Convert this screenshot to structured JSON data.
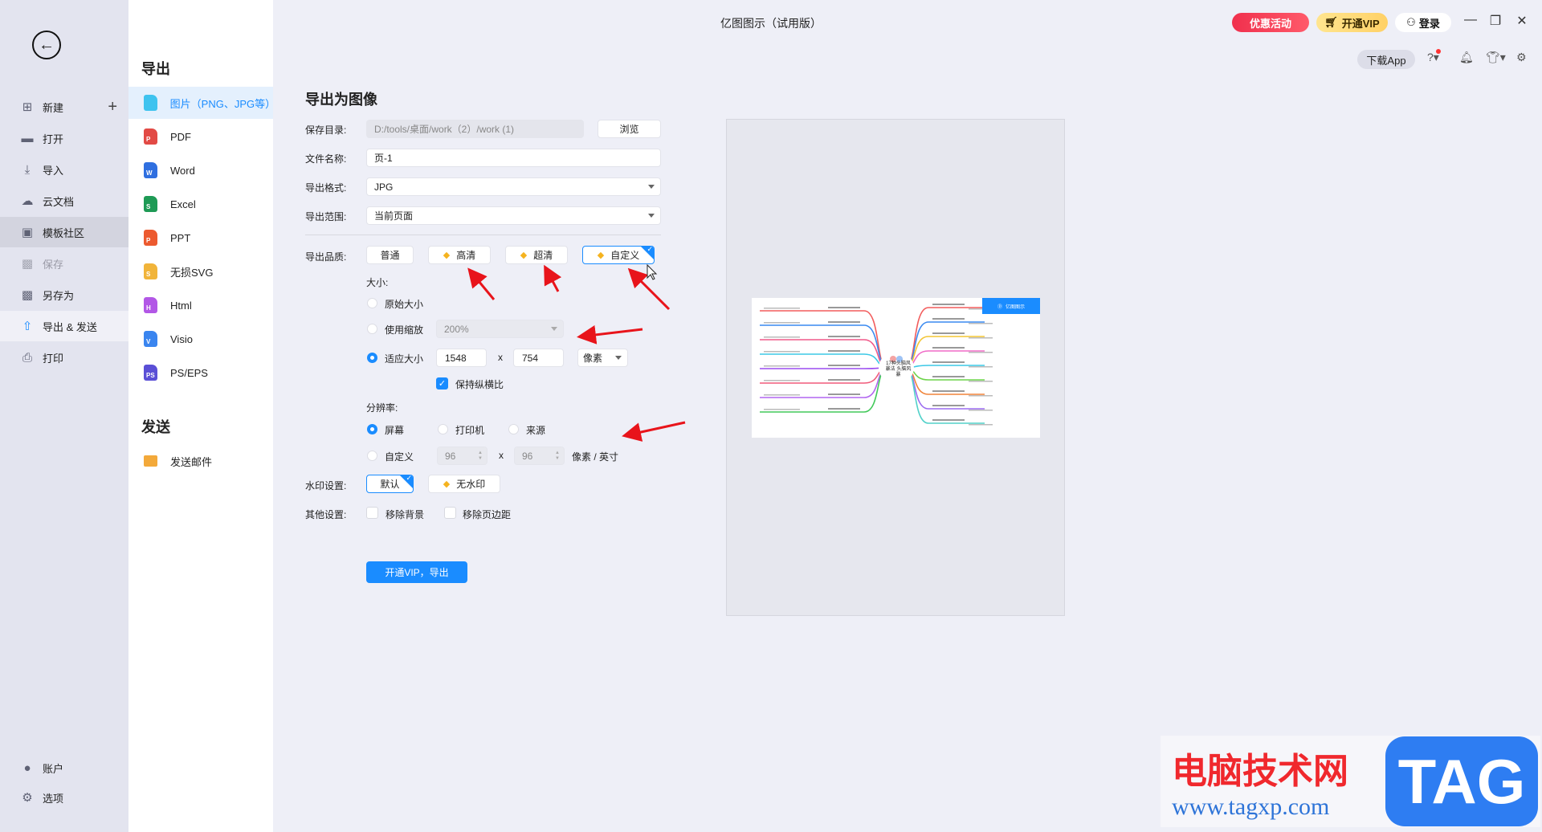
{
  "window": {
    "title": "亿图图示（试用版）",
    "promo": "优惠活动",
    "vip": "开通VIP",
    "login": "登录",
    "download_app": "下载App"
  },
  "sidebar": {
    "items": [
      {
        "label": "新建",
        "icon": "plus-square-icon"
      },
      {
        "label": "打开",
        "icon": "folder-icon"
      },
      {
        "label": "导入",
        "icon": "import-icon"
      },
      {
        "label": "云文档",
        "icon": "cloud-icon"
      },
      {
        "label": "模板社区",
        "icon": "community-icon"
      },
      {
        "label": "保存",
        "icon": "save-icon"
      },
      {
        "label": "另存为",
        "icon": "save-as-icon"
      },
      {
        "label": "导出 & 发送",
        "icon": "export-icon"
      },
      {
        "label": "打印",
        "icon": "printer-icon"
      }
    ],
    "bottom": [
      {
        "label": "账户",
        "icon": "account-icon"
      },
      {
        "label": "选项",
        "icon": "gear-icon"
      }
    ]
  },
  "panel": {
    "export_heading": "导出",
    "export_items": [
      {
        "label": "图片（PNG、JPG等）",
        "color": "#3ec3ef",
        "letter": ""
      },
      {
        "label": "PDF",
        "color": "#e24a45",
        "letter": "P"
      },
      {
        "label": "Word",
        "color": "#2f6fe0",
        "letter": "W"
      },
      {
        "label": "Excel",
        "color": "#1e9a55",
        "letter": "S"
      },
      {
        "label": "PPT",
        "color": "#ec5a2f",
        "letter": "P"
      },
      {
        "label": "无损SVG",
        "color": "#f1b43a",
        "letter": "S"
      },
      {
        "label": "Html",
        "color": "#b257e6",
        "letter": "H"
      },
      {
        "label": "Visio",
        "color": "#3a85ef",
        "letter": "V"
      },
      {
        "label": "PS/EPS",
        "color": "#5a4fd6",
        "letter": "PS"
      }
    ],
    "send_heading": "发送",
    "send_items": [
      {
        "label": "发送邮件",
        "color": "#f3a93a"
      }
    ]
  },
  "form": {
    "title": "导出为图像",
    "save_dir": {
      "label": "保存目录:",
      "value": "D:/tools/桌面/work（2）/work (1)",
      "browse": "浏览"
    },
    "file_name": {
      "label": "文件名称:",
      "value": "页-1"
    },
    "format": {
      "label": "导出格式:",
      "value": "JPG"
    },
    "range": {
      "label": "导出范围:",
      "value": "当前页面"
    },
    "quality": {
      "label": "导出品质:",
      "options": [
        "普通",
        "高清",
        "超清",
        "自定义"
      ],
      "selected": "自定义"
    },
    "size": {
      "label": "大小:",
      "original": "原始大小",
      "scale": "使用缩放",
      "scale_value": "200%",
      "fit": "适应大小",
      "width": "1548",
      "x": "x",
      "height": "754",
      "unit": "像素",
      "keep_ratio": "保持纵横比",
      "selected": "适应大小"
    },
    "resolution": {
      "label": "分辨率:",
      "screen": "屏幕",
      "printer": "打印机",
      "source": "来源",
      "custom": "自定义",
      "dpi_x": "96",
      "x": "x",
      "dpi_y": "96",
      "unit": "像素 / 英寸",
      "selected": "屏幕"
    },
    "watermark": {
      "label": "水印设置:",
      "default": "默认",
      "none": "无水印",
      "selected": "默认"
    },
    "other": {
      "label": "其他设置:",
      "remove_bg": "移除背景",
      "remove_margin": "移除页边距"
    },
    "export_button": "开通VIP，导出"
  },
  "preview": {
    "center_label": "17种头脑风暴法 头脑风暴",
    "logo": "亿图图示"
  },
  "watermark_site": {
    "name": "电脑技术网",
    "url": "www.tagxp.com",
    "tag": "TAG"
  },
  "colors": {
    "accent": "#1a8cff",
    "annotation_arrow": "#e8141b"
  }
}
